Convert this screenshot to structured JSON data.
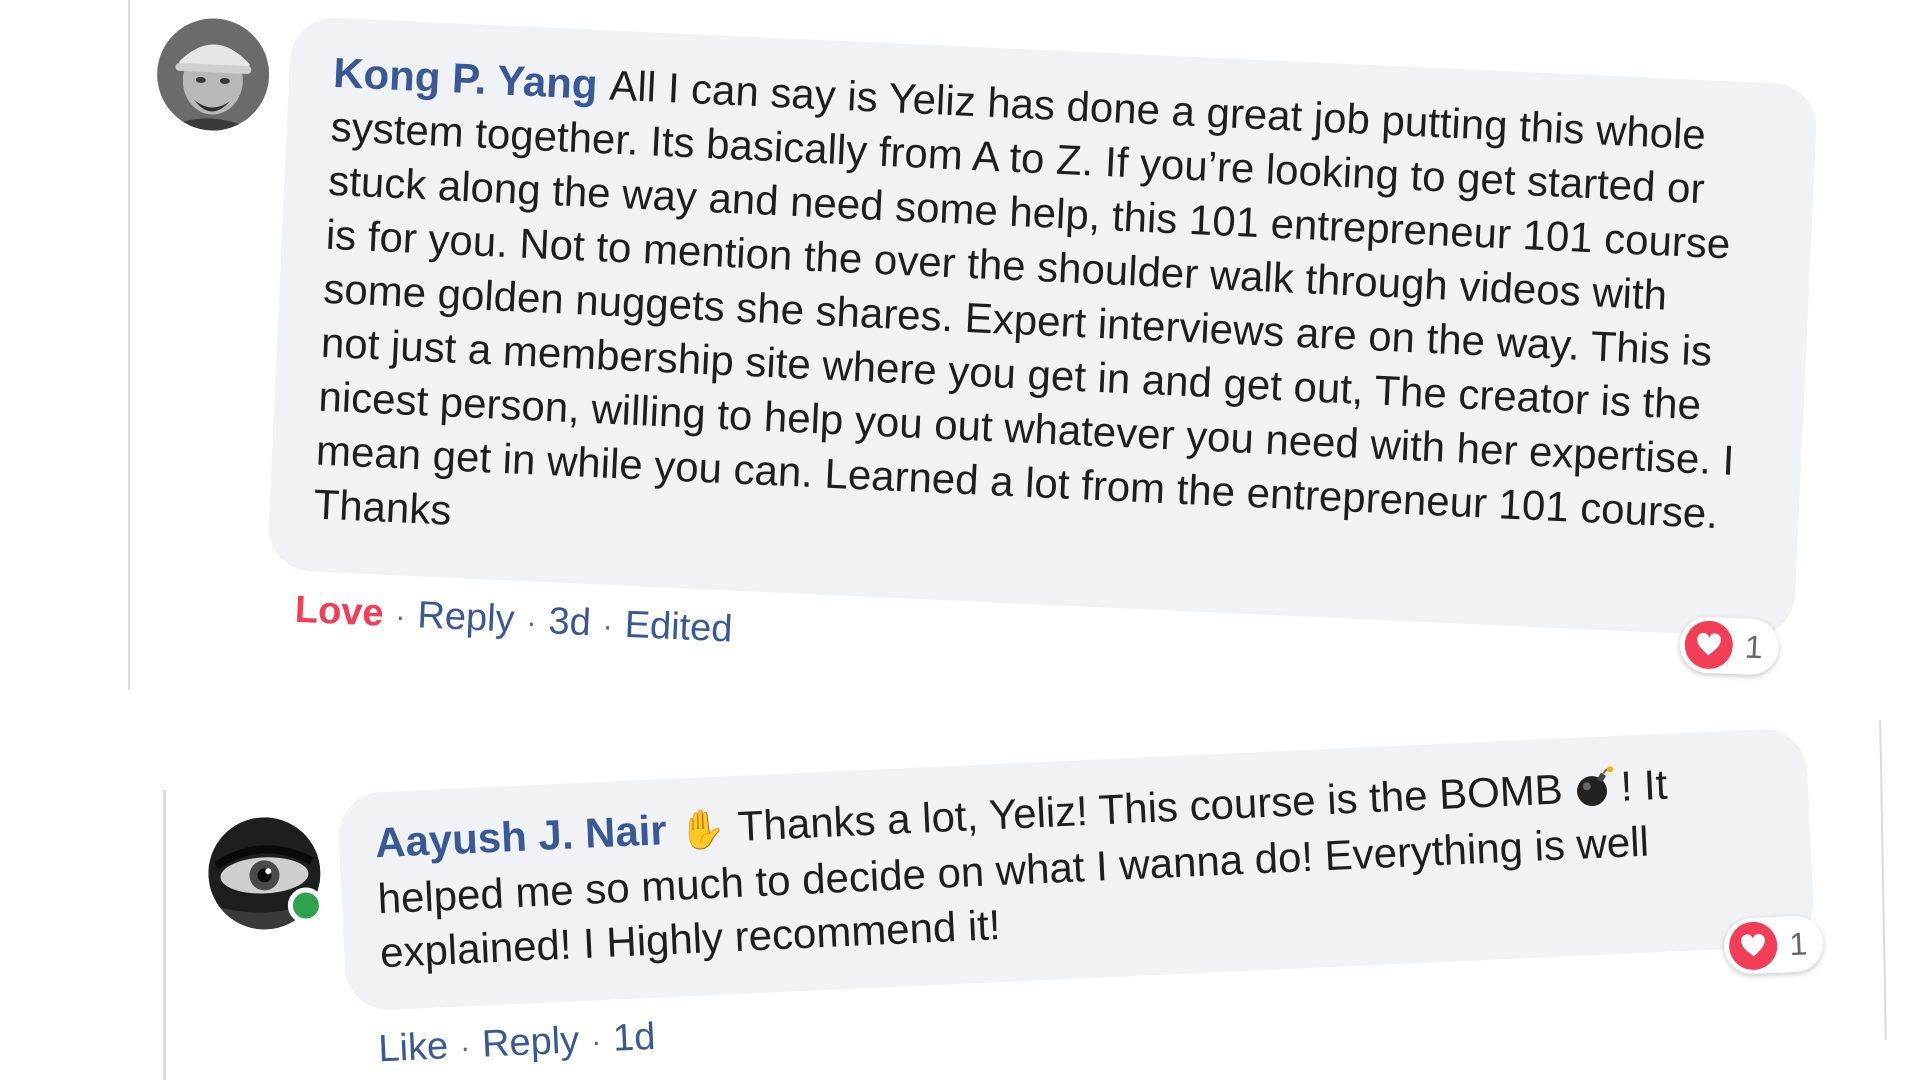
{
  "comments": [
    {
      "author": "Kong P. Yang",
      "text": "All I can say is Yeliz has done a great job putting this whole system together. Its basically from A to Z. If you’re looking to get started or stuck along the way and need some help, this 101 entrepreneur 101 course is for you. Not to mention the over the shoulder walk through videos with some golden nuggets she shares. Expert interviews are on the way. This is not just a membership site where you get in and get out, The creator is the nicest person, willing to help you out whatever you need with her expertise. I mean get in while you can. Learned a lot from the entrepreneur 101 course. Thanks",
      "avatar_icon": "user-avatar-cap",
      "reaction_icon": "heart-icon",
      "reaction_count": "1",
      "actions": {
        "reaction_label": "Love",
        "reply_label": "Reply",
        "time": "3d",
        "edited_label": "Edited"
      }
    },
    {
      "author": "Aayush J. Nair",
      "author_icon": "waving-hand-icon",
      "text_before_icon": "Thanks a lot, Yeliz! This course is the BOMB",
      "inline_icon": "bomb-icon",
      "text_after_icon": "! It helped me so much to decide on what I wanna do! Everything is well explained! I Highly recommend it!",
      "avatar_icon": "user-avatar-eye",
      "online": true,
      "reaction_icon": "heart-icon",
      "reaction_count": "1",
      "actions": {
        "like_label": "Like",
        "reply_label": "Reply",
        "time": "1d"
      }
    }
  ],
  "colors": {
    "bubble_bg": "#f0f2f5",
    "author_name": "#385898",
    "love_red": "#f33e58",
    "meta_gray": "#65676b",
    "online_green": "#31a24c"
  }
}
